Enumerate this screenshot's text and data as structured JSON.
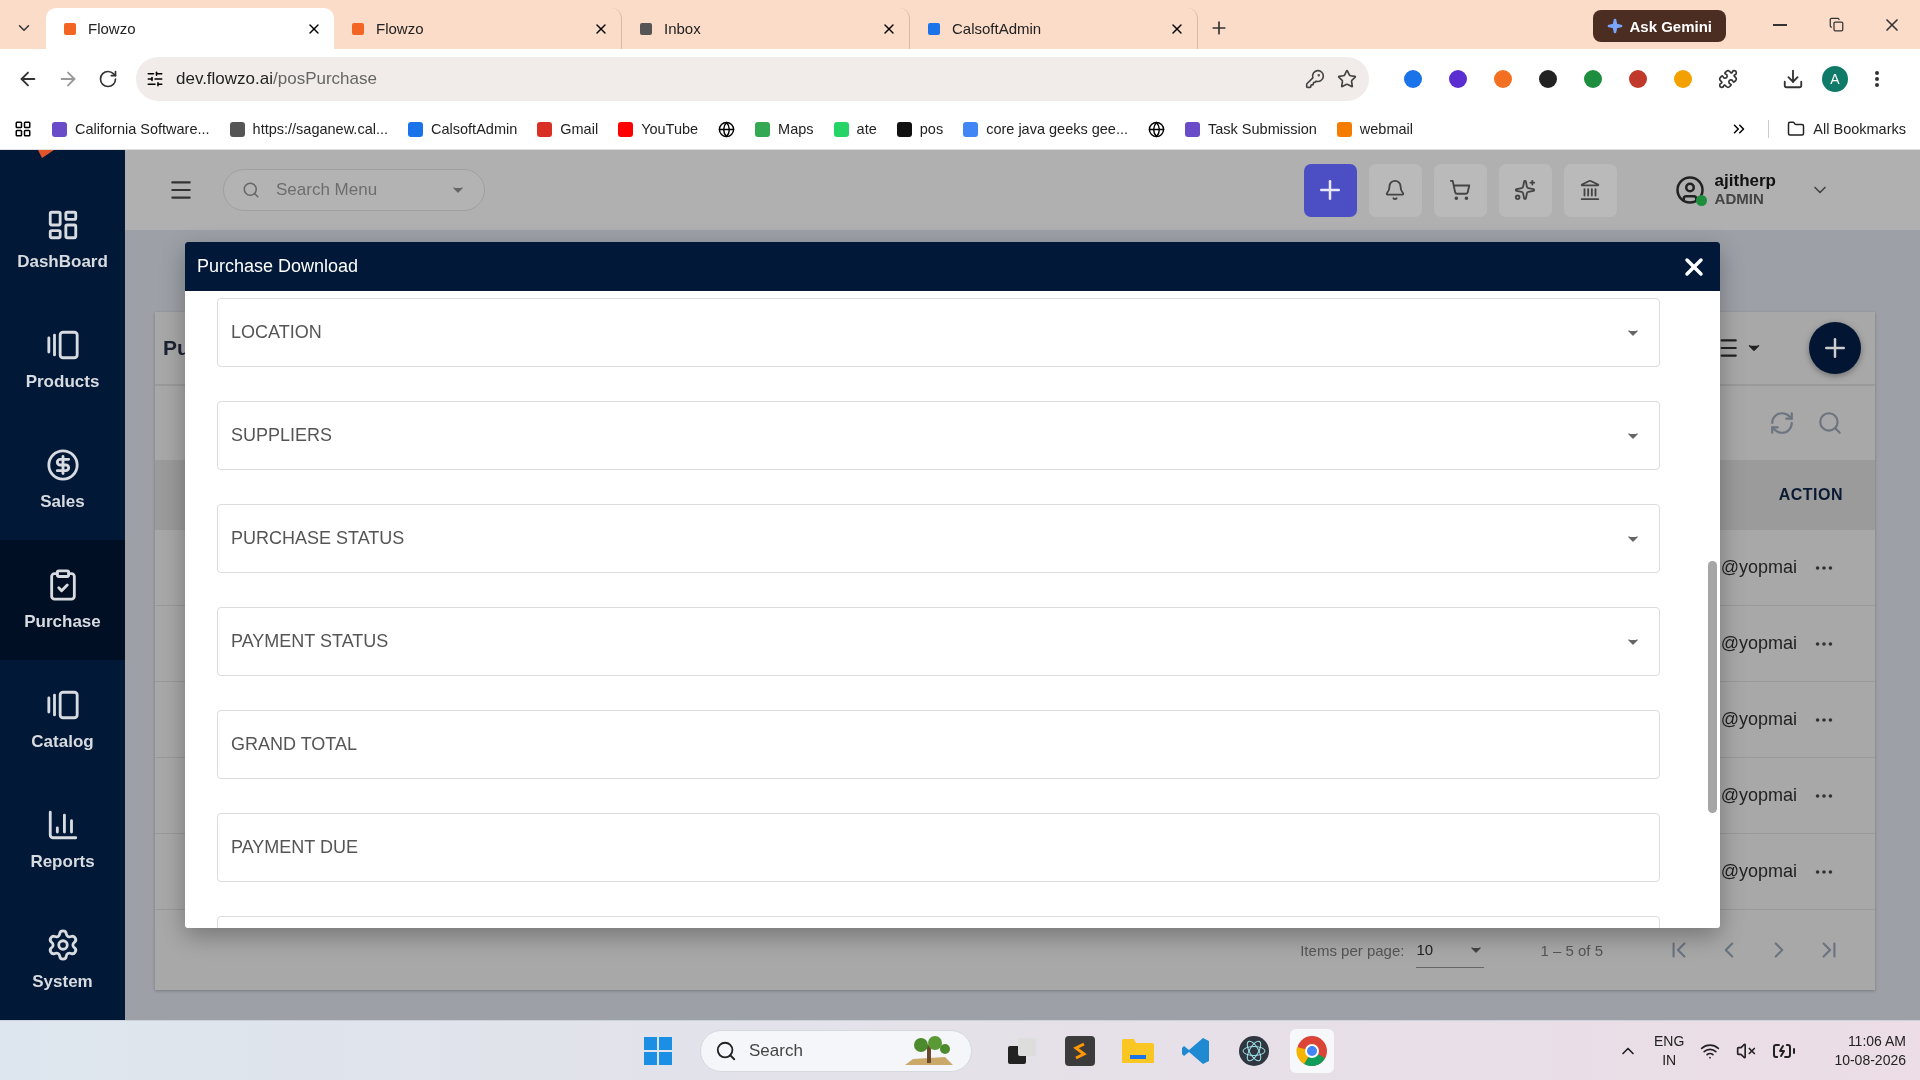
{
  "browser": {
    "tabs": [
      {
        "title": "Flowzo",
        "selected": true
      },
      {
        "title": "Flowzo",
        "selected": false
      },
      {
        "title": "Inbox",
        "selected": false
      },
      {
        "title": "CalsoftAdmin",
        "selected": false
      }
    ],
    "gemini_button": "Ask Gemini",
    "address": {
      "host": "dev.flowzo.ai",
      "path": "/posPurchase"
    },
    "profile_initial": "A",
    "bookmarks": [
      {
        "kind": "link",
        "label": "California Software..."
      },
      {
        "kind": "link",
        "label": "https://saganew.cal..."
      },
      {
        "kind": "link",
        "label": "CalsoftAdmin"
      },
      {
        "kind": "link",
        "label": "Gmail"
      },
      {
        "kind": "link",
        "label": "YouTube"
      },
      {
        "kind": "icon"
      },
      {
        "kind": "link",
        "label": "Maps"
      },
      {
        "kind": "link",
        "label": "ate"
      },
      {
        "kind": "link",
        "label": "pos"
      },
      {
        "kind": "link",
        "label": "core java geeks gee..."
      },
      {
        "kind": "icon"
      },
      {
        "kind": "link",
        "label": "Task Submission"
      },
      {
        "kind": "link",
        "label": "webmail"
      }
    ],
    "all_bookmarks": "All Bookmarks"
  },
  "sidebar": {
    "items": [
      {
        "label": "DashBoard",
        "selected": false
      },
      {
        "label": "Products",
        "selected": false
      },
      {
        "label": "Sales",
        "selected": false
      },
      {
        "label": "Purchase",
        "selected": true
      },
      {
        "label": "Catalog",
        "selected": false
      },
      {
        "label": "Reports",
        "selected": false
      },
      {
        "label": "System",
        "selected": false
      }
    ]
  },
  "header": {
    "search": {
      "placeholder": "Search Menu"
    },
    "user": {
      "name": "ajitherp",
      "role": "ADMIN"
    }
  },
  "page": {
    "card_title": "Pu",
    "table": {
      "columns": [
        "ACTION"
      ],
      "rows": [
        {
          "email": "@yopmai"
        },
        {
          "email": "@yopmai"
        },
        {
          "email": "@yopmai"
        },
        {
          "email": "@yopmai"
        },
        {
          "email": "@yopmai"
        }
      ]
    },
    "pagination": {
      "label": "Items per page:",
      "page_size": "10",
      "range": "1 – 5 of 5"
    }
  },
  "modal": {
    "title": "Purchase Download",
    "fields": [
      {
        "kind": "select",
        "placeholder": "LOCATION"
      },
      {
        "kind": "select",
        "placeholder": "SUPPLIERS"
      },
      {
        "kind": "select",
        "placeholder": "PURCHASE STATUS"
      },
      {
        "kind": "select",
        "placeholder": "PAYMENT STATUS"
      },
      {
        "kind": "text",
        "placeholder": "GRAND TOTAL"
      },
      {
        "kind": "text",
        "placeholder": "PAYMENT DUE"
      },
      {
        "kind": "text"
      }
    ]
  },
  "taskbar": {
    "search": {
      "placeholder": "Search"
    },
    "language": [
      "ENG",
      "IN"
    ],
    "time": "11:06 AM",
    "date": "10-08-2026"
  }
}
